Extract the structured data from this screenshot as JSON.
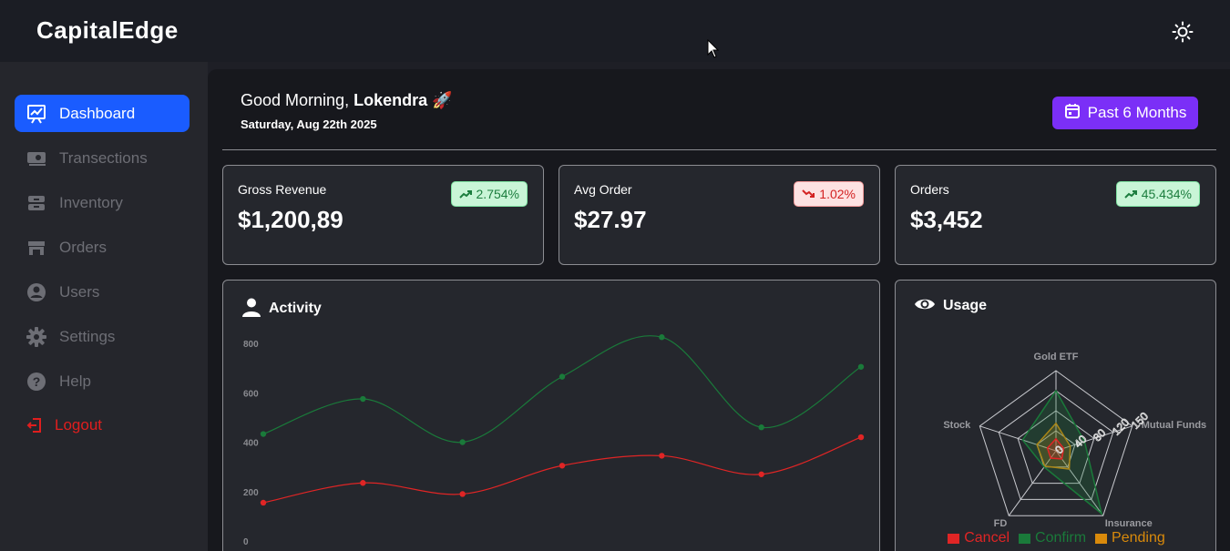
{
  "app": {
    "brand": "CapitalEdge"
  },
  "sidebar": {
    "items": [
      {
        "label": "Dashboard",
        "icon": "chart-board-icon",
        "active": true
      },
      {
        "label": "Transections",
        "icon": "money-icon",
        "active": false
      },
      {
        "label": "Inventory",
        "icon": "inventory-icon",
        "active": false
      },
      {
        "label": "Orders",
        "icon": "store-icon",
        "active": false
      },
      {
        "label": "Users",
        "icon": "user-circle-icon",
        "active": false
      },
      {
        "label": "Settings",
        "icon": "gear-icon",
        "active": false
      },
      {
        "label": "Help",
        "icon": "help-icon",
        "active": false
      }
    ],
    "logout": {
      "label": "Logout",
      "icon": "logout-icon"
    }
  },
  "header": {
    "greeting": "Good Morning,",
    "user_name": "Lokendra",
    "emoji": "🚀",
    "date": "Saturday, Aug 22th 2025",
    "period_label": "Past 6 Months"
  },
  "stats": [
    {
      "title": "Gross Revenue",
      "currency": "$",
      "value": "1,200,89",
      "change": "2.754%",
      "trend": "up"
    },
    {
      "title": "Avg Order",
      "currency": "$",
      "value": "27.97",
      "change": "1.02%",
      "trend": "down"
    },
    {
      "title": "Orders",
      "currency": "$",
      "value": "3,452",
      "change": "45.434%",
      "trend": "up"
    }
  ],
  "activity": {
    "title": "Activity"
  },
  "usage": {
    "title": "Usage"
  },
  "colors": {
    "accent": "#1a5cff",
    "purple": "#7b2ff7",
    "green": "#1a7a3a",
    "red": "#e02525",
    "orange": "#d98a0b"
  },
  "chart_data": [
    {
      "type": "line",
      "ylim": [
        0,
        800
      ],
      "yticks": [
        0,
        200,
        400,
        600,
        800
      ],
      "series": [
        {
          "color": "#1a7a3a",
          "values": [
            433,
            575,
            400,
            665,
            825,
            460,
            705
          ]
        },
        {
          "color": "#e02525",
          "values": [
            155,
            235,
            190,
            305,
            345,
            270,
            420
          ]
        }
      ]
    },
    {
      "type": "radar",
      "axes": [
        "Gold ETF",
        "Mutual Funds",
        "Insurance",
        "FD",
        "Stock"
      ],
      "rticks": [
        "0",
        "40",
        "80",
        "120",
        "150"
      ],
      "rmax": 160,
      "series": [
        {
          "name": "Cancel",
          "color": "#e02525",
          "values": [
            24,
            16,
            20,
            18,
            18
          ]
        },
        {
          "name": "Confirm",
          "color": "#1a7a3a",
          "values": [
            120,
            60,
            155,
            40,
            70
          ]
        },
        {
          "name": "Pending",
          "color": "#d98a0b",
          "values": [
            55,
            30,
            45,
            38,
            40
          ]
        }
      ]
    }
  ]
}
